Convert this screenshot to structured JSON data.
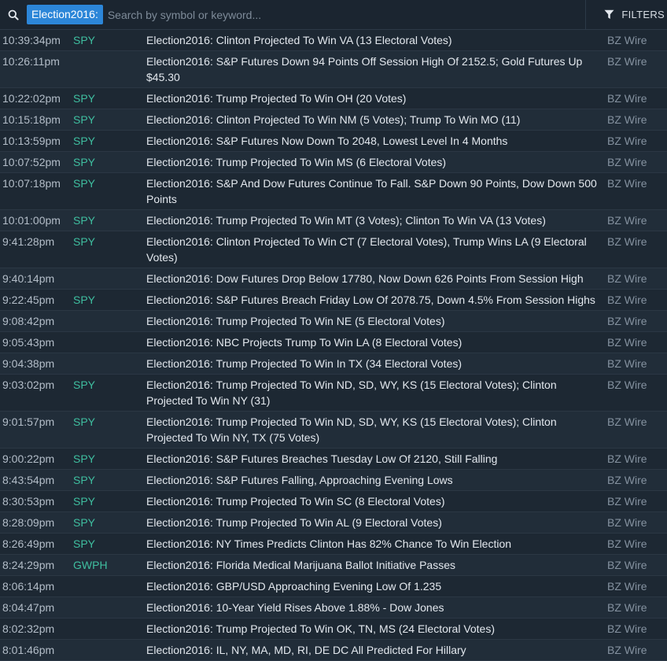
{
  "search": {
    "tag": "Election2016:",
    "placeholder": "Search by symbol or keyword..."
  },
  "filters_label": "FILTERS",
  "colors": {
    "tag_bg": "#2c86d8",
    "symbol": "#3fbfa0",
    "background": "#1d2833"
  },
  "rows": [
    {
      "time": "10:39:34pm",
      "symbol": "SPY",
      "title": "Election2016: Clinton Projected To Win VA (13 Electoral Votes)",
      "source": "BZ Wire"
    },
    {
      "time": "10:26:11pm",
      "symbol": "",
      "title": "Election2016: S&P Futures Down 94 Points Off Session High Of 2152.5; Gold Futures Up $45.30",
      "source": "BZ Wire"
    },
    {
      "time": "10:22:02pm",
      "symbol": "SPY",
      "title": "Election2016: Trump Projected To Win OH (20 Votes)",
      "source": "BZ Wire"
    },
    {
      "time": "10:15:18pm",
      "symbol": "SPY",
      "title": "Election2016: Clinton Projected To Win NM (5 Votes); Trump To Win MO (11)",
      "source": "BZ Wire"
    },
    {
      "time": "10:13:59pm",
      "symbol": "SPY",
      "title": "Election2016: S&P Futures Now Down To 2048, Lowest Level In 4 Months",
      "source": "BZ Wire"
    },
    {
      "time": "10:07:52pm",
      "symbol": "SPY",
      "title": "Election2016: Trump Projected To Win MS (6 Electoral Votes)",
      "source": "BZ Wire"
    },
    {
      "time": "10:07:18pm",
      "symbol": "SPY",
      "title": "Election2016: S&P And Dow Futures Continue To Fall. S&P Down 90 Points, Dow Down 500 Points",
      "source": "BZ Wire"
    },
    {
      "time": "10:01:00pm",
      "symbol": "SPY",
      "title": "Election2016: Trump Projected To Win MT (3 Votes); Clinton To Win VA (13 Votes)",
      "source": "BZ Wire"
    },
    {
      "time": "9:41:28pm",
      "symbol": "SPY",
      "title": "Election2016: Clinton Projected To Win CT (7 Electoral Votes), Trump Wins LA (9 Electoral Votes)",
      "source": "BZ Wire"
    },
    {
      "time": "9:40:14pm",
      "symbol": "",
      "title": "Election2016: Dow Futures Drop Below 17780, Now Down 626 Points From Session High",
      "source": "BZ Wire"
    },
    {
      "time": "9:22:45pm",
      "symbol": "SPY",
      "title": "Election2016: S&P Futures Breach Friday Low Of 2078.75, Down 4.5% From Session Highs",
      "source": "BZ Wire"
    },
    {
      "time": "9:08:42pm",
      "symbol": "",
      "title": "Election2016: Trump Projected To Win NE (5 Electoral Votes)",
      "source": "BZ Wire"
    },
    {
      "time": "9:05:43pm",
      "symbol": "",
      "title": "Election2016: NBC Projects Trump To Win LA (8 Electoral Votes)",
      "source": "BZ Wire"
    },
    {
      "time": "9:04:38pm",
      "symbol": "",
      "title": "Election2016: Trump Projected To Win In TX (34 Electoral Votes)",
      "source": "BZ Wire"
    },
    {
      "time": "9:03:02pm",
      "symbol": "SPY",
      "title": "Election2016: Trump Projected To Win ND, SD, WY, KS (15 Electoral Votes); Clinton Projected To Win NY (31)",
      "source": "BZ Wire"
    },
    {
      "time": "9:01:57pm",
      "symbol": "SPY",
      "title": "Election2016: Trump Projected To Win ND, SD, WY, KS (15 Electoral Votes); Clinton Projected To Win NY, TX (75 Votes)",
      "source": "BZ Wire"
    },
    {
      "time": "9:00:22pm",
      "symbol": "SPY",
      "title": "Election2016: S&P Futures Breaches Tuesday Low Of 2120, Still Falling",
      "source": "BZ Wire"
    },
    {
      "time": "8:43:54pm",
      "symbol": "SPY",
      "title": "Election2016: S&P Futures Falling, Approaching Evening Lows",
      "source": "BZ Wire"
    },
    {
      "time": "8:30:53pm",
      "symbol": "SPY",
      "title": "Election2016: Trump Projected To Win SC (8 Electoral Votes)",
      "source": "BZ Wire"
    },
    {
      "time": "8:28:09pm",
      "symbol": "SPY",
      "title": "Election2016: Trump Projected To Win AL (9 Electoral Votes)",
      "source": "BZ Wire"
    },
    {
      "time": "8:26:49pm",
      "symbol": "SPY",
      "title": "Election2016: NY Times Predicts Clinton Has 82% Chance To Win Election",
      "source": "BZ Wire"
    },
    {
      "time": "8:24:29pm",
      "symbol": "GWPH",
      "title": "Election2016: Florida Medical Marijuana Ballot Initiative Passes",
      "source": "BZ Wire"
    },
    {
      "time": "8:06:14pm",
      "symbol": "",
      "title": "Election2016: GBP/USD Approaching Evening Low Of 1.235",
      "source": "BZ Wire"
    },
    {
      "time": "8:04:47pm",
      "symbol": "",
      "title": "Election2016: 10-Year Yield Rises Above 1.88% - Dow Jones",
      "source": "BZ Wire"
    },
    {
      "time": "8:02:32pm",
      "symbol": "",
      "title": "Election2016: Trump Projected To Win OK, TN, MS (24 Electoral Votes)",
      "source": "BZ Wire"
    },
    {
      "time": "8:01:46pm",
      "symbol": "",
      "title": "Election2016: IL, NY, MA, MD, RI, DE DC All Predicted For Hillary",
      "source": "BZ Wire"
    }
  ]
}
